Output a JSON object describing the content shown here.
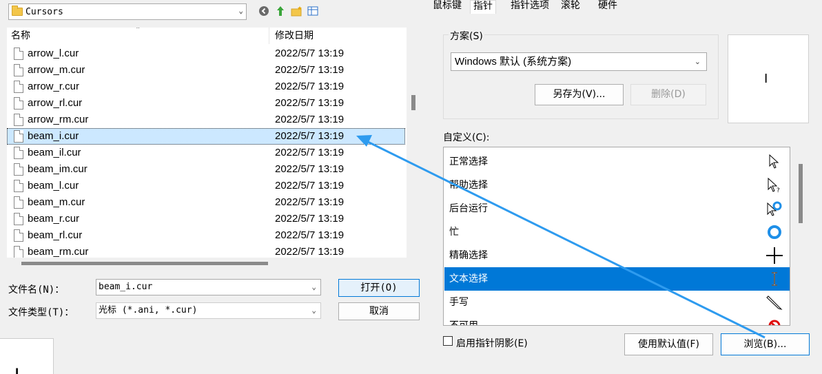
{
  "open_dialog": {
    "look_in": "Cursors",
    "columns": {
      "name": "名称",
      "date": "修改日期"
    },
    "files": [
      {
        "name": "arrow_l.cur",
        "date": "2022/5/7 13:19"
      },
      {
        "name": "arrow_m.cur",
        "date": "2022/5/7 13:19"
      },
      {
        "name": "arrow_r.cur",
        "date": "2022/5/7 13:19"
      },
      {
        "name": "arrow_rl.cur",
        "date": "2022/5/7 13:19"
      },
      {
        "name": "arrow_rm.cur",
        "date": "2022/5/7 13:19"
      },
      {
        "name": "beam_i.cur",
        "date": "2022/5/7 13:19",
        "selected": true
      },
      {
        "name": "beam_il.cur",
        "date": "2022/5/7 13:19"
      },
      {
        "name": "beam_im.cur",
        "date": "2022/5/7 13:19"
      },
      {
        "name": "beam_l.cur",
        "date": "2022/5/7 13:19"
      },
      {
        "name": "beam_m.cur",
        "date": "2022/5/7 13:19"
      },
      {
        "name": "beam_r.cur",
        "date": "2022/5/7 13:19"
      },
      {
        "name": "beam_rl.cur",
        "date": "2022/5/7 13:19"
      },
      {
        "name": "beam_rm.cur",
        "date": "2022/5/7 13:19"
      }
    ],
    "file_name_label": "文件名(N)：",
    "file_name_value": "beam_i.cur",
    "file_type_label": "文件类型(T)：",
    "file_type_value": "光标 (*.ani, *.cur)",
    "open_label": "打开(O)",
    "cancel_label": "取消",
    "corner_cursor": "I"
  },
  "mouse_props": {
    "tabs": [
      {
        "label": "鼠标键",
        "active": false
      },
      {
        "label": "指针",
        "active": true
      },
      {
        "label": "指针选项",
        "active": false
      },
      {
        "label": "滚轮",
        "active": false
      },
      {
        "label": "硬件",
        "active": false
      }
    ],
    "scheme_label": "方案(S)",
    "scheme_value": "Windows 默认 (系统方案)",
    "save_as_label": "另存为(V)...",
    "delete_label": "删除(D)",
    "preview_cursor": "I",
    "customize_label": "自定义(C):",
    "cursors": [
      {
        "label": "正常选择",
        "icon": "arrow-pointer-icon"
      },
      {
        "label": "帮助选择",
        "icon": "help-select-icon"
      },
      {
        "label": "后台运行",
        "icon": "working-in-background-icon"
      },
      {
        "label": "忙",
        "icon": "busy-ring-icon"
      },
      {
        "label": "精确选择",
        "icon": "crosshair-icon"
      },
      {
        "label": "文本选择",
        "icon": "text-beam-icon",
        "selected": true
      },
      {
        "label": "手写",
        "icon": "pen-icon"
      },
      {
        "label": "不可用",
        "icon": "unavailable-icon"
      }
    ],
    "shadow_label": "启用指针阴影(E)",
    "use_default_label": "使用默认值(F)",
    "browse_label": "浏览(B)...",
    "accent_color": "#0078d7",
    "annotation_arrow_color": "#2e9bef"
  }
}
